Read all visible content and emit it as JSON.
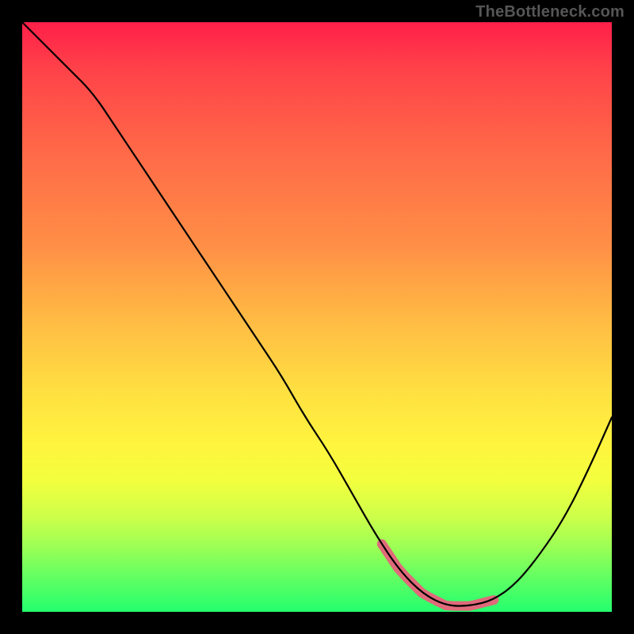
{
  "attribution": "TheBottleneck.com",
  "colors": {
    "background": "#000000",
    "gradient_top": "#ff1f49",
    "gradient_bottom": "#24ff6e",
    "curve": "#000000",
    "highlight": "#e0697a"
  },
  "chart_data": {
    "type": "line",
    "title": "",
    "xlabel": "",
    "ylabel": "",
    "xlim": [
      0,
      100
    ],
    "ylim": [
      0,
      100
    ],
    "grid": false,
    "legend": false,
    "x": [
      0,
      4,
      8,
      12,
      16,
      20,
      24,
      28,
      32,
      36,
      40,
      44,
      48,
      52,
      56,
      60,
      64,
      68,
      72,
      76,
      80,
      84,
      88,
      92,
      96,
      100
    ],
    "y": [
      100,
      96,
      92,
      88,
      82,
      76,
      70,
      64,
      58,
      52,
      46,
      40,
      33,
      27,
      20,
      13,
      7,
      3,
      1,
      1,
      2,
      5,
      10,
      16,
      24,
      33
    ],
    "highlight_range_x": [
      61,
      80
    ],
    "annotations": []
  }
}
